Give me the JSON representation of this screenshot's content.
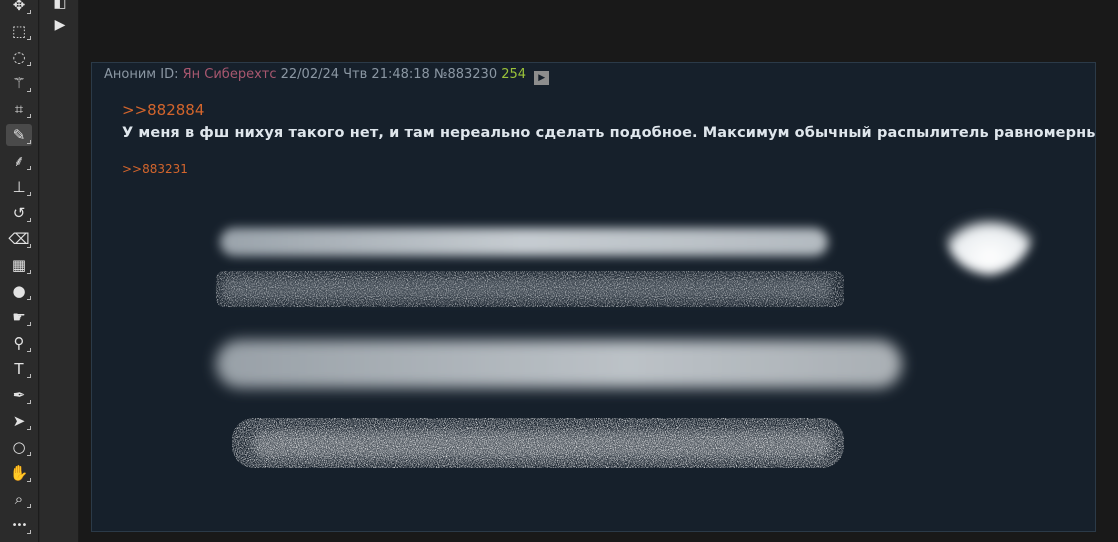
{
  "tools": [
    {
      "name": "move-tool",
      "icon": "move-icon",
      "glyph": "✥"
    },
    {
      "name": "marquee-tool",
      "icon": "rect-marquee-icon",
      "glyph": "⬚"
    },
    {
      "name": "lasso-tool",
      "icon": "lasso-icon",
      "glyph": "◌"
    },
    {
      "name": "magic-wand-tool",
      "icon": "magic-wand-icon",
      "glyph": "⚚"
    },
    {
      "name": "crop-tool",
      "icon": "crop-icon",
      "glyph": "⌗"
    },
    {
      "name": "brush-tool",
      "icon": "brush-icon",
      "glyph": "✎",
      "active": true
    },
    {
      "name": "mixer-brush-tool",
      "icon": "mixer-brush-icon",
      "glyph": "⸙"
    },
    {
      "name": "clone-stamp-tool",
      "icon": "stamp-icon",
      "glyph": "⊥"
    },
    {
      "name": "history-brush-tool",
      "icon": "history-brush-icon",
      "glyph": "↺"
    },
    {
      "name": "eraser-tool",
      "icon": "eraser-icon",
      "glyph": "⌫"
    },
    {
      "name": "gradient-tool",
      "icon": "gradient-icon",
      "glyph": "▦"
    },
    {
      "name": "blur-tool",
      "icon": "drop-icon",
      "glyph": "●"
    },
    {
      "name": "smudge-tool",
      "icon": "smudge-icon",
      "glyph": "☛"
    },
    {
      "name": "dodge-tool",
      "icon": "dodge-icon",
      "glyph": "⚲"
    },
    {
      "name": "type-tool",
      "icon": "type-icon",
      "glyph": "T"
    },
    {
      "name": "pen-tool",
      "icon": "pen-icon",
      "glyph": "✒"
    },
    {
      "name": "path-selection-tool",
      "icon": "arrow-cursor-icon",
      "glyph": "➤"
    },
    {
      "name": "ellipse-tool",
      "icon": "ellipse-icon",
      "glyph": "○"
    },
    {
      "name": "hand-tool",
      "icon": "hand-icon",
      "glyph": "✋"
    },
    {
      "name": "zoom-tool",
      "icon": "zoom-icon",
      "glyph": "⌕"
    },
    {
      "name": "more-tools",
      "icon": "more-icon",
      "glyph": "•••"
    }
  ],
  "panel": {
    "play_glyph": "▶",
    "tabs_glyph": "◧"
  },
  "post": {
    "header": {
      "prefix": "Аноним ID:",
      "name": "Ян Сиберехтс",
      "date": "22/02/24 Чтв 21:48:18",
      "number": "№883230",
      "count": "254",
      "play": "▶"
    },
    "reply1": ">>882884",
    "text": "У меня в фш нихуя такого нет, и там нереально сделать подобное. Максимум обычный распылитель равномерный.",
    "reply2": ">>883231"
  },
  "colors": {
    "accent_link": "#d3652c",
    "name": "#a8576f",
    "count": "#9ac23a",
    "post_bg": "#16202b"
  }
}
